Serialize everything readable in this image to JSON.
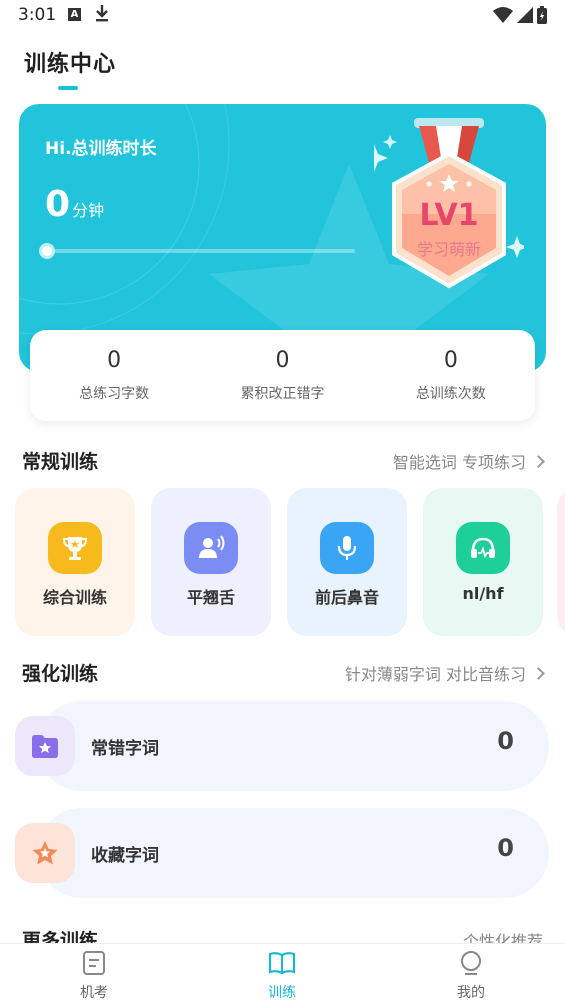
{
  "status_bar": {
    "time": "3:01"
  },
  "header": {
    "title": "训练中心"
  },
  "hero": {
    "greeting": "Hi.总训练时长",
    "duration_value": "0",
    "duration_unit": "分钟",
    "progress": 0,
    "badge_level": "LV1",
    "badge_name": "学习萌新"
  },
  "stats": [
    {
      "value": "0",
      "label": "总练习字数"
    },
    {
      "value": "0",
      "label": "累积改正错字"
    },
    {
      "value": "0",
      "label": "总训练次数"
    }
  ],
  "regular": {
    "title": "常规训练",
    "link": "智能选词 专项练习",
    "items": [
      {
        "label": "综合训练",
        "icon": "trophy-icon",
        "bg": "#fff4ea",
        "icon_bg": "#f8b91c"
      },
      {
        "label": "平翘舌",
        "icon": "speaker-person-icon",
        "bg": "#eef0fd",
        "icon_bg": "#7b8cf3"
      },
      {
        "label": "前后鼻音",
        "icon": "microphone-icon",
        "bg": "#e8f3fd",
        "icon_bg": "#3aa5f5"
      },
      {
        "label": "nl/hf",
        "icon": "headphones-icon",
        "bg": "#e8f8f2",
        "icon_bg": "#1ecf99"
      }
    ]
  },
  "strengthen": {
    "title": "强化训练",
    "link": "针对薄弱字词 对比音练习",
    "items": [
      {
        "label": "常错字词",
        "count": "0",
        "icon": "star-folder-icon",
        "icon_bg": "#ece7fb"
      },
      {
        "label": "收藏字词",
        "count": "0",
        "icon": "star-icon",
        "icon_bg": "#fde4d8"
      }
    ]
  },
  "more": {
    "title": "更多训练",
    "link": "个性化推荐"
  },
  "tabbar": {
    "tabs": [
      {
        "label": "机考",
        "icon": "exam-icon"
      },
      {
        "label": "训练",
        "icon": "book-icon",
        "active": true
      },
      {
        "label": "我的",
        "icon": "profile-icon"
      }
    ]
  }
}
